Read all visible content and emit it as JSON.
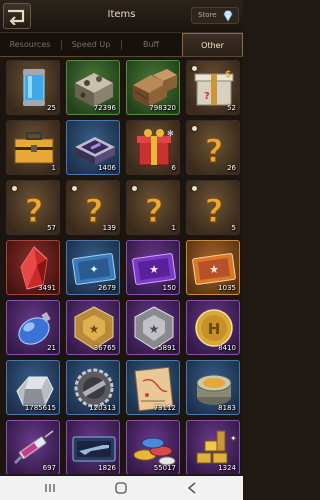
{
  "header": {
    "title": "Items",
    "store_label": "Store",
    "back_icon": "back-arrow-icon",
    "store_icon": "diamond-icon"
  },
  "tabs": [
    {
      "label": "Resources",
      "active": false
    },
    {
      "label": "Speed Up",
      "active": false
    },
    {
      "label": "Buff",
      "active": false
    },
    {
      "label": "Other",
      "active": true
    }
  ],
  "items": [
    {
      "icon": "blue-capsule-icon",
      "frame": "brown",
      "count": "25"
    },
    {
      "icon": "camo-crate-icon",
      "frame": "green",
      "count": "72396"
    },
    {
      "icon": "wooden-crates-icon",
      "frame": "green",
      "count": "798320"
    },
    {
      "icon": "gift-box-question-icon",
      "frame": "brown",
      "count": "52"
    },
    {
      "icon": "toolbox-icon",
      "frame": "brown",
      "count": "1"
    },
    {
      "icon": "purple-case-icon",
      "frame": "blue",
      "count": "1406"
    },
    {
      "icon": "red-gift-box-icon",
      "frame": "brown",
      "count": "6"
    },
    {
      "icon": "question-mark-icon",
      "frame": "brown",
      "count": "26"
    },
    {
      "icon": "question-mark-icon",
      "frame": "brown",
      "count": "57"
    },
    {
      "icon": "question-mark-icon",
      "frame": "brown",
      "count": "139"
    },
    {
      "icon": "question-mark-icon",
      "frame": "brown",
      "count": "1"
    },
    {
      "icon": "question-mark-icon",
      "frame": "brown",
      "count": "5"
    },
    {
      "icon": "red-crystal-icon",
      "frame": "red",
      "count": "3491"
    },
    {
      "icon": "blue-ticket-icon",
      "frame": "blue",
      "count": "2679"
    },
    {
      "icon": "purple-ticket-icon",
      "frame": "purple",
      "count": "150"
    },
    {
      "icon": "orange-ticket-icon",
      "frame": "orange",
      "count": "1035"
    },
    {
      "icon": "blue-potion-icon",
      "frame": "purple",
      "count": "21"
    },
    {
      "icon": "gold-medal-icon",
      "frame": "purple",
      "count": "36765"
    },
    {
      "icon": "silver-medal-icon",
      "frame": "purple",
      "count": "5891"
    },
    {
      "icon": "gold-coin-icon",
      "frame": "purple",
      "count": "8410"
    },
    {
      "icon": "steel-ingot-icon",
      "frame": "blue",
      "count": "1785615"
    },
    {
      "icon": "gear-emblem-icon",
      "frame": "blue",
      "count": "120313"
    },
    {
      "icon": "map-scroll-icon",
      "frame": "blue",
      "count": "73112"
    },
    {
      "icon": "tin-can-icon",
      "frame": "blue",
      "count": "8183"
    },
    {
      "icon": "syringe-icon",
      "frame": "purple",
      "count": "697"
    },
    {
      "icon": "rifle-case-icon",
      "frame": "purple",
      "count": "1826"
    },
    {
      "icon": "chips-icon",
      "frame": "purple",
      "count": "55017"
    },
    {
      "icon": "gold-bars-icon",
      "frame": "purple",
      "count": "1324"
    }
  ],
  "navbar": {
    "recent_icon": "recent-apps-icon",
    "home_icon": "home-icon",
    "back_icon": "nav-back-icon"
  }
}
